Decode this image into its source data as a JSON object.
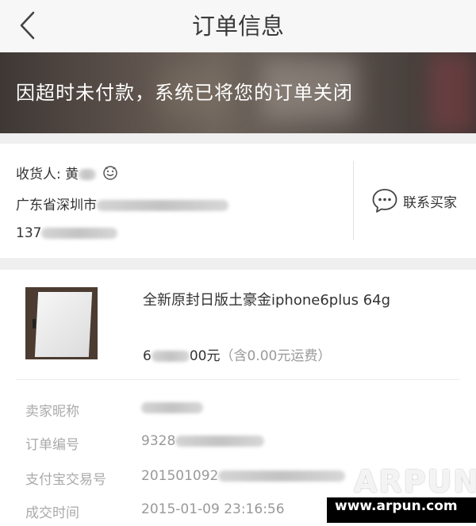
{
  "nav": {
    "title": "订单信息",
    "back_icon": "chevron-left-icon"
  },
  "banner": {
    "message": "因超时未付款，系统已将您的订单关闭"
  },
  "consignee": {
    "label": "收货人: 黄",
    "address": "广东省深圳市",
    "phone": "137",
    "emoji_icon": "smile-icon"
  },
  "contact": {
    "label": "联系买家",
    "icon": "chat-bubble-icon"
  },
  "product": {
    "title": "全新原封日版土豪金iphone6plus 64g",
    "price_prefix": "6",
    "price_suffix": "00元",
    "shipping": "（含0.00元运费）"
  },
  "details": [
    {
      "label": "卖家昵称",
      "value": ""
    },
    {
      "label": "订单编号",
      "value": "9328"
    },
    {
      "label": "支付宝交易号",
      "value": "201501092"
    },
    {
      "label": "成交时间",
      "value": "2015-01-09 23:16:56"
    }
  ],
  "watermark": {
    "brand": "ARPUN",
    "url": "www.arpun.com"
  }
}
